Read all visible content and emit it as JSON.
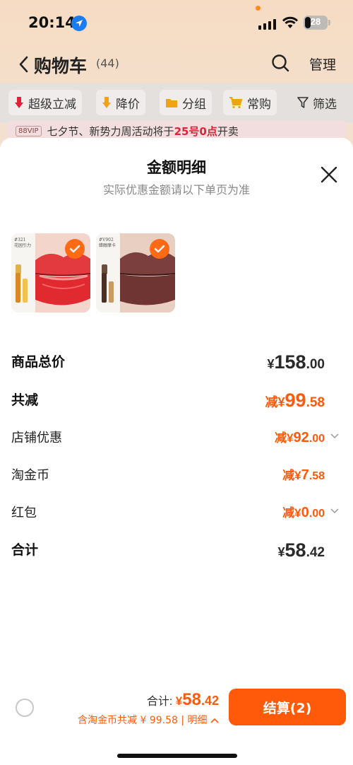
{
  "status_bar": {
    "time": "20:14",
    "battery_level": "28"
  },
  "nav": {
    "title": "购物车",
    "count": "(44)",
    "manage_label": "管理"
  },
  "filters": {
    "chips": [
      "超级立减",
      "降价",
      "分组",
      "常购"
    ],
    "filter_label": "筛选"
  },
  "promo": {
    "badge": "88VIP",
    "text_before": "七夕节、新势力周活动将于",
    "highlight": "25号0点",
    "text_after": "开卖"
  },
  "sheet": {
    "title": "金额明细",
    "subtitle": "实际优惠金额请以下单页为准",
    "products": [
      {
        "label_line1": "#321",
        "label_line2": "花园引力",
        "selected": true
      },
      {
        "label_line1": "#V902",
        "label_line2": "蜡醇摩卡",
        "selected": true
      }
    ],
    "rows": [
      {
        "label": "商品总价",
        "prefix": "¥",
        "int": "158",
        "dec": ".00"
      },
      {
        "label": "共减",
        "prefix": "减¥",
        "int": "99",
        "dec": ".58"
      },
      {
        "label": "店铺优惠",
        "prefix": "减¥",
        "int": "92",
        "dec": ".00"
      },
      {
        "label": "淘金币",
        "prefix": "减¥",
        "int": "7",
        "dec": ".58"
      },
      {
        "label": "红包",
        "prefix": "减¥",
        "int": "0",
        "dec": ".00"
      },
      {
        "label": "合计",
        "prefix": "¥",
        "int": "58",
        "dec": ".42"
      }
    ]
  },
  "bottom": {
    "total_label": "合计: ",
    "total_prefix": "¥",
    "total_int": "58",
    "total_dec": ".42",
    "discount_text": "含淘金币共减 ¥ 99.58",
    "detail_label": "| 明细",
    "checkout_label": "结算(2)"
  },
  "colors": {
    "accent": "#ff5a0a",
    "check": "#ff6a14",
    "promo_highlight": "#e0223a"
  }
}
